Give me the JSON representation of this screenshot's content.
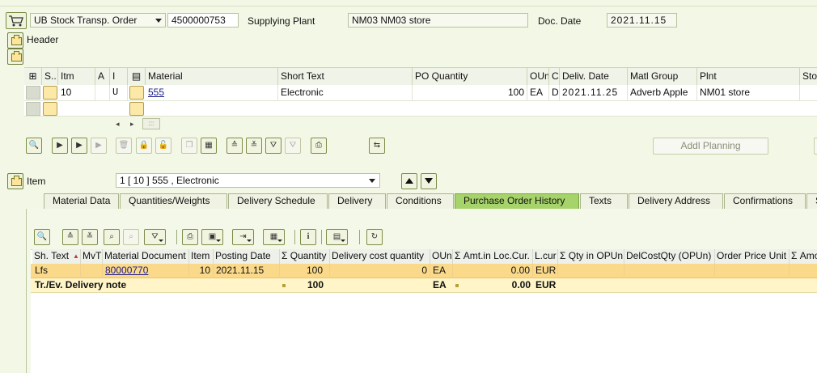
{
  "header": {
    "doc_type": "UB Stock Transp. Order",
    "doc_number": "4500000753",
    "supplying_plant_label": "Supplying Plant",
    "supplying_plant_value": "NM03 NM03 store",
    "doc_date_label": "Doc. Date",
    "doc_date_value": "2021.11.15",
    "header_label": "Header"
  },
  "items_table": {
    "columns": [
      "S..",
      "Itm",
      "A",
      "I",
      "",
      "Material",
      "Short Text",
      "PO Quantity",
      "OUn",
      "C",
      "Deliv. Date",
      "Matl Group",
      "Plnt",
      "Sto"
    ],
    "rows": [
      {
        "item": "10",
        "acct": "",
        "cat": "U",
        "material": "555",
        "short_text": "Electronic",
        "po_quantity": "100",
        "oun": "EA",
        "c": "D",
        "deliv_date": "2021.11.25",
        "matl_group": "Adverb Apple",
        "plant": "NM01 store"
      }
    ],
    "scroll_glyph": ":::"
  },
  "buttons": {
    "addl_planning": "Addl Planning"
  },
  "item_section": {
    "label": "Item",
    "selected": "1 [ 10 ] 555 , Electronic"
  },
  "tabs": [
    "Material Data",
    "Quantities/Weights",
    "Delivery Schedule",
    "Delivery",
    "Conditions",
    "Purchase Order History",
    "Texts",
    "Delivery Address",
    "Confirmations",
    "S"
  ],
  "active_tab": "Purchase Order History",
  "history_table": {
    "columns": [
      "Sh. Text",
      "MvT",
      "Material Document",
      "Item",
      "Posting Date",
      "Σ Quantity",
      "Delivery cost quantity",
      "OUn",
      "Σ Amt.in Loc.Cur.",
      "L.cur",
      "Σ Qty in OPUn",
      "DelCostQty (OPUn)",
      "Order Price Unit",
      "Σ Amo"
    ],
    "rows": [
      {
        "sh_text": "Lfs",
        "mvt": "",
        "mat_doc": "80000770",
        "item": "10",
        "posting_date": "2021.11.15",
        "quantity": "100",
        "del_cost_qty": "0",
        "oun": "EA",
        "amount": "0.00",
        "lcur": "EUR"
      }
    ],
    "total_row": {
      "label": "Tr./Ev. Delivery note",
      "quantity": "100",
      "oun": "EA",
      "amount": "0.00",
      "lcur": "EUR"
    }
  },
  "colors": {
    "background": "#f3f8e6",
    "active_tab": "#a7d36b",
    "selected_row": "#fbd98a",
    "total_row": "#fff5c8"
  }
}
